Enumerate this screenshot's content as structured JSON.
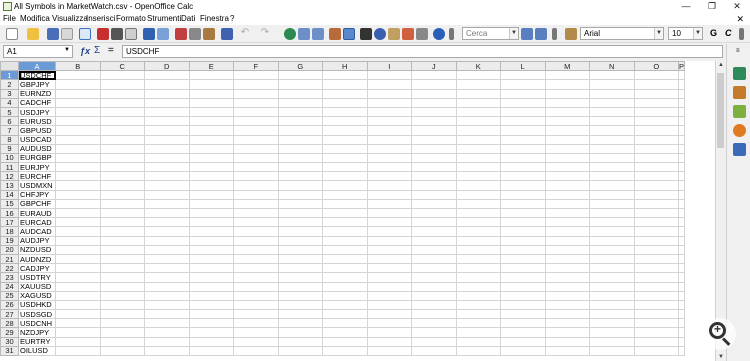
{
  "window": {
    "title": "All Symbols in MarketWatch.csv - OpenOffice Calc",
    "minimize": "—",
    "maximize": "❐",
    "close": "✕"
  },
  "menu": {
    "items": [
      "File",
      "Modifica",
      "Visualizza",
      "Inserisci",
      "Formato",
      "Strumenti",
      "Dati",
      "Finestra",
      "?"
    ],
    "close": "✕"
  },
  "toolbar": {
    "search_placeholder": "Cerca",
    "font_name": "Arial",
    "font_size": "10",
    "bold_label": "G",
    "italic_label": "C"
  },
  "formula_bar": {
    "cell_ref": "A1",
    "fx_label": "ƒx",
    "sum_label": "Σ",
    "equals_label": "=",
    "content": "USDCHF"
  },
  "sheet": {
    "columns": [
      "A",
      "B",
      "C",
      "D",
      "E",
      "F",
      "G",
      "H",
      "I",
      "J",
      "K",
      "L",
      "M",
      "N",
      "O",
      "P"
    ],
    "rows": [
      {
        "n": "1",
        "a": "USDCHF"
      },
      {
        "n": "2",
        "a": "GBPJPY"
      },
      {
        "n": "3",
        "a": "EURNZD"
      },
      {
        "n": "4",
        "a": "CADCHF"
      },
      {
        "n": "5",
        "a": "USDJPY"
      },
      {
        "n": "6",
        "a": "EURUSD"
      },
      {
        "n": "7",
        "a": "GBPUSD"
      },
      {
        "n": "8",
        "a": "USDCAD"
      },
      {
        "n": "9",
        "a": "AUDUSD"
      },
      {
        "n": "10",
        "a": "EURGBP"
      },
      {
        "n": "11",
        "a": "EURJPY"
      },
      {
        "n": "12",
        "a": "EURCHF"
      },
      {
        "n": "13",
        "a": "USDMXN"
      },
      {
        "n": "14",
        "a": "CHFJPY"
      },
      {
        "n": "15",
        "a": "GBPCHF"
      },
      {
        "n": "16",
        "a": "EURAUD"
      },
      {
        "n": "17",
        "a": "EURCAD"
      },
      {
        "n": "18",
        "a": "AUDCAD"
      },
      {
        "n": "19",
        "a": "AUDJPY"
      },
      {
        "n": "20",
        "a": "NZDUSD"
      },
      {
        "n": "21",
        "a": "AUDNZD"
      },
      {
        "n": "22",
        "a": "CADJPY"
      },
      {
        "n": "23",
        "a": "USDTRY"
      },
      {
        "n": "24",
        "a": "XAUUSD"
      },
      {
        "n": "25",
        "a": "XAGUSD"
      },
      {
        "n": "26",
        "a": "USDHKD"
      },
      {
        "n": "27",
        "a": "USDSGD"
      },
      {
        "n": "28",
        "a": "USDCNH"
      },
      {
        "n": "29",
        "a": "NZDJPY"
      },
      {
        "n": "30",
        "a": "EURTRY"
      },
      {
        "n": "31",
        "a": "OILUSD"
      }
    ]
  },
  "colors": {
    "header_selected": "#6b9bd6",
    "accent": "#1e5fb4"
  }
}
